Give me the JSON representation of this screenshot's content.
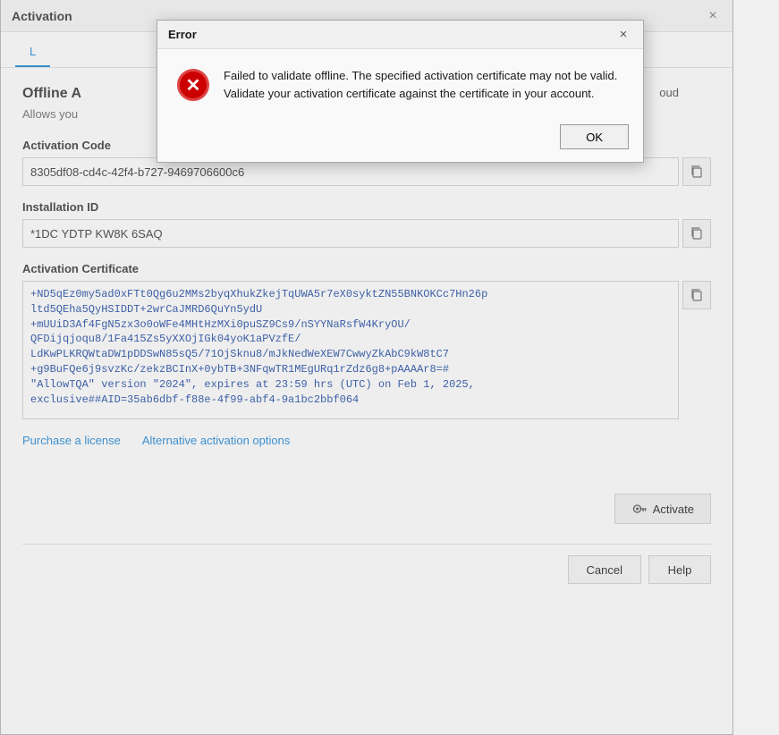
{
  "mainWindow": {
    "title": "Activation",
    "closeLabel": "×"
  },
  "tabs": {
    "active": "L",
    "cloud": "oud"
  },
  "offlineSection": {
    "title": "Offline A",
    "description": "Allows you"
  },
  "activationCode": {
    "label": "Activation Code",
    "value": "8305df08-cd4c-42f4-b727-9469706600c6",
    "copyTooltip": "Copy"
  },
  "installationId": {
    "label": "Installation ID",
    "value": "*1DC YDTP KW8K 6SAQ",
    "copyTooltip": "Copy"
  },
  "activationCertificate": {
    "label": "Activation Certificate",
    "value": "+ND5qEz0my5ad0xFTt0Qg6u2MMs2byqXhukZkejTqUWA5r7eX0syktZN55BNKOKCc7Hn26p\nltd5QEha5QyHSIDDT+2wrCaJMRD6QuYn5ydU\n+mUUiD3Af4FgN5zx3o0oWFe4MHtHzMXi0puSZ9Cs9/nSYYNaRsfW4KryOU/\nQFDijqjoqu8/1Fa415Zs5yXXOjIGk04yoK1aPVzfE/\nLdKwPLKRQWtaDW1pDDSwN85sQ5/71OjSknu8/mJkNedWeXEW7CwwyZkAbC9kW8tC7\n+g9BuFQe6j9svzKc/zekzBCInX+0ybTB+3NFqwTR1MEgURq1rZdz6g8+pAAAAr8=#\n\"AllowTQA\" version \"2024\", expires at 23:59 hrs (UTC) on Feb 1, 2025,\nexclusive##AID=35ab6dbf-f88e-4f99-abf4-9a1bc2bbf064",
    "copyTooltip": "Copy"
  },
  "links": {
    "purchaseLicense": "Purchase a license",
    "alternativeActivation": "Alternative activation options"
  },
  "activateButton": {
    "label": "Activate",
    "icon": "key-icon"
  },
  "footerButtons": {
    "cancel": "Cancel",
    "help": "Help"
  },
  "errorDialog": {
    "title": "Error",
    "closeLabel": "×",
    "message": "Failed to validate offline. The specified activation certificate may not be valid. Validate your activation certificate against the certificate in your account.",
    "okLabel": "OK",
    "iconSymbol": "✕"
  }
}
